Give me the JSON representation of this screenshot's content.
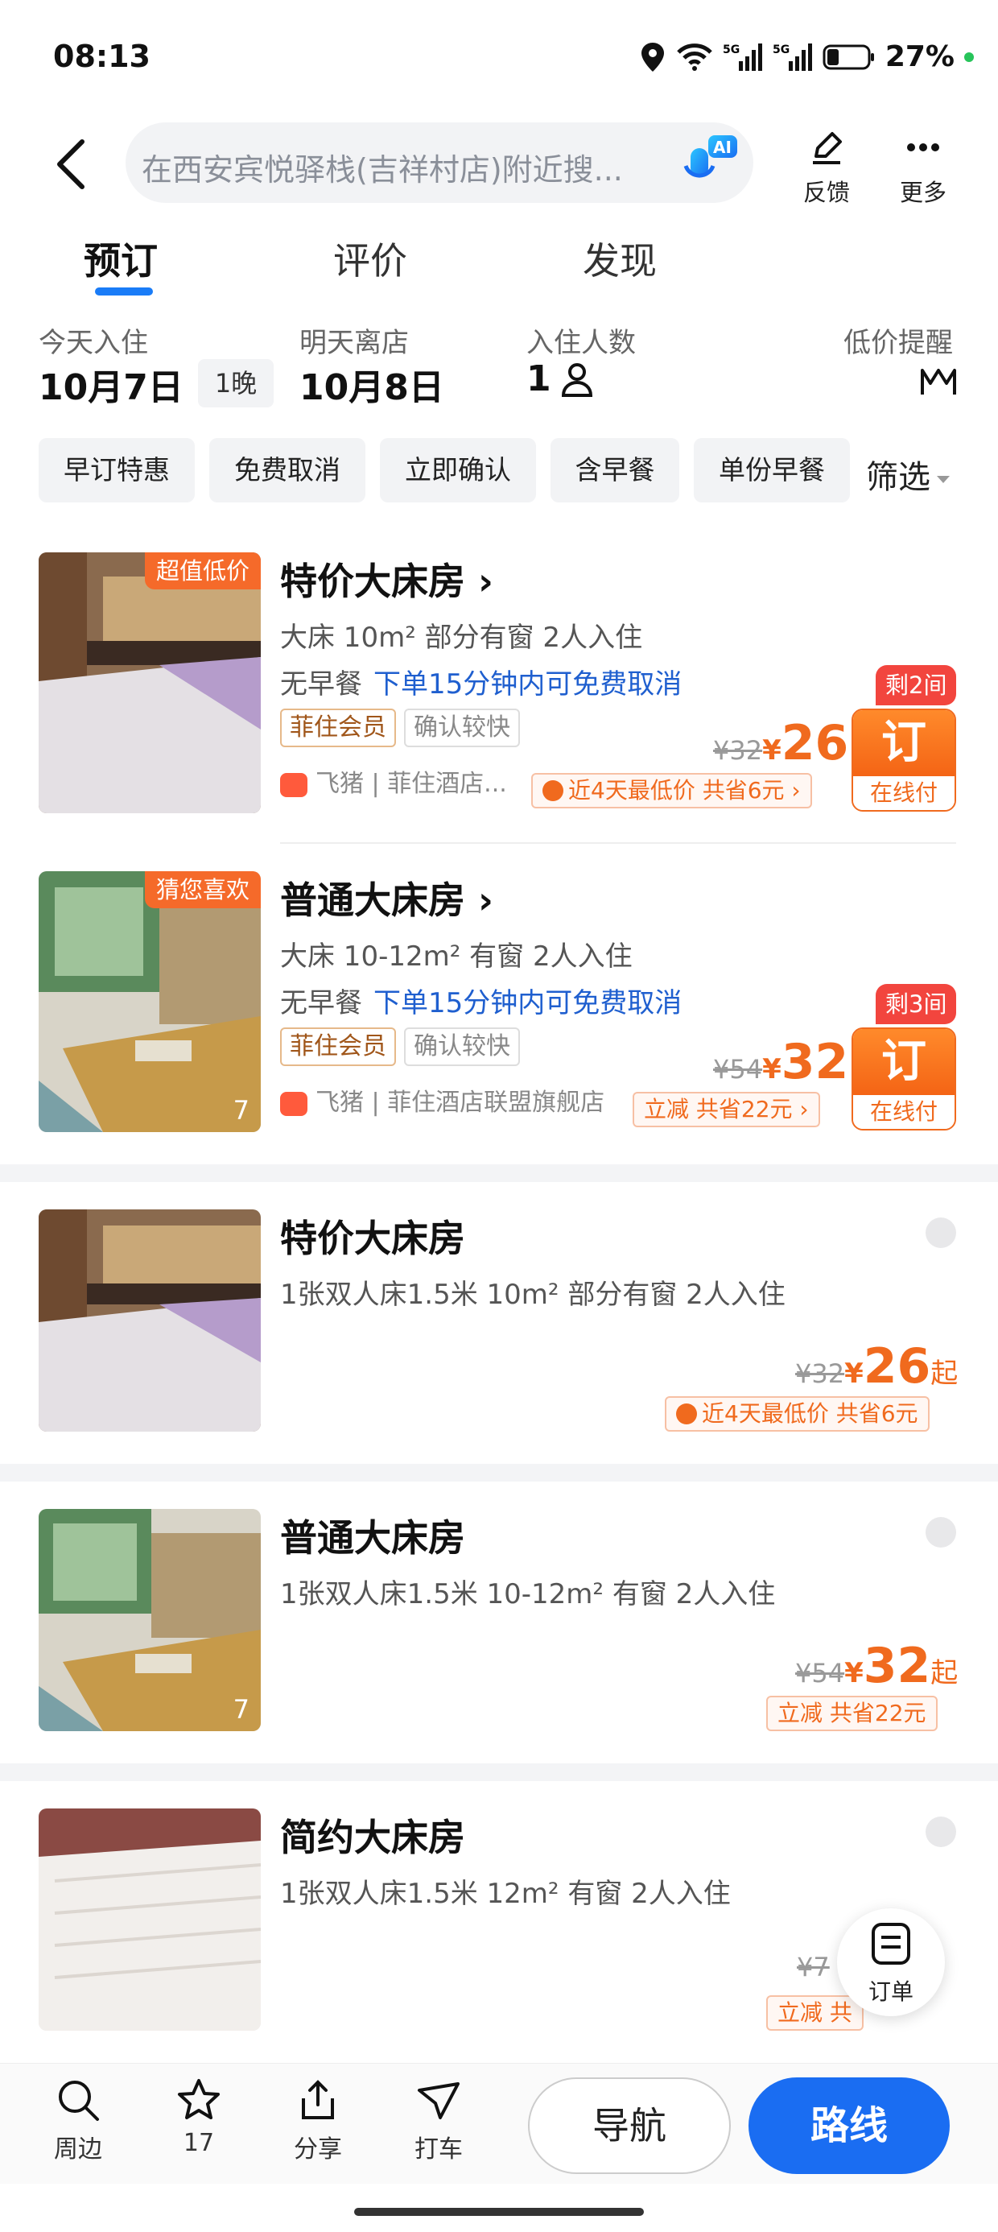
{
  "status_bar": {
    "time": "08:13",
    "battery": "27%"
  },
  "header": {
    "search_placeholder": "在西安宾悦驿栈(吉祥村店)附近搜...",
    "ai_label": "AI",
    "feedback_label": "反馈",
    "more_label": "更多"
  },
  "tabs": [
    {
      "label": "预订"
    },
    {
      "label": "评价"
    },
    {
      "label": "发现"
    }
  ],
  "dates": {
    "checkin_label": "今天入住",
    "checkin_value": "10月7日",
    "nights": "1晚",
    "checkout_label": "明天离店",
    "checkout_value": "10月8日",
    "guests_label": "入住人数",
    "guests_value": "1",
    "price_alert_label": "低价提醒"
  },
  "filters": {
    "chips": [
      "早订特惠",
      "免费取消",
      "立即确认",
      "含早餐",
      "单份早餐"
    ],
    "more_label": "筛选"
  },
  "featured_rooms": [
    {
      "badge": "超值低价",
      "name": "特价大床房",
      "spec": "大床  10m²  部分有窗  2人入住",
      "breakfast": "无早餐",
      "cancel": "下单15分钟内可免费取消",
      "member_tag": "菲住会员",
      "confirm_tag": "确认较快",
      "vendor_a": "飞猪",
      "vendor_b": "菲住酒店...",
      "remaining": "剩2间",
      "original_price": "¥32",
      "currency": "¥",
      "price": "26",
      "promo": "近4天最低价  共省6元 ›",
      "book_label": "订",
      "pay_label": "在线付"
    },
    {
      "badge": "猜您喜欢",
      "name": "普通大床房",
      "spec": "大床  10-12m²  有窗  2人入住",
      "breakfast": "无早餐",
      "cancel": "下单15分钟内可免费取消",
      "member_tag": "菲住会员",
      "confirm_tag": "确认较快",
      "vendor_a": "飞猪",
      "vendor_b": "菲住酒店联盟旗舰店",
      "remaining": "剩3间",
      "original_price": "¥54",
      "currency": "¥",
      "price": "32",
      "promo": "立减  共省22元 ›",
      "photo_count": "7",
      "book_label": "订",
      "pay_label": "在线付"
    }
  ],
  "room_types": [
    {
      "name": "特价大床房",
      "spec": "1张双人床1.5米  10m²  部分有窗  2人入住",
      "original_price": "¥32",
      "currency": "¥",
      "price": "26",
      "suffix": "起",
      "promo": "近4天最低价  共省6元"
    },
    {
      "name": "普通大床房",
      "spec": "1张双人床1.5米  10-12m²  有窗  2人入住",
      "original_price": "¥54",
      "currency": "¥",
      "price": "32",
      "suffix": "起",
      "promo": "立减  共省22元",
      "photo_count": "7"
    },
    {
      "name": "简约大床房",
      "spec": "1张双人床1.5米  12m²  有窗  2人入住",
      "original_price": "¥7",
      "promo": "立减  共"
    }
  ],
  "order_fab": {
    "label": "订单"
  },
  "bottom_bar": {
    "nearby": "周边",
    "favorites": "17",
    "share": "分享",
    "taxi": "打车",
    "navigate": "导航",
    "route": "路线"
  },
  "colors": {
    "accent": "#1a6df2",
    "price": "#f06a1e",
    "badge": "#f56a2a"
  }
}
